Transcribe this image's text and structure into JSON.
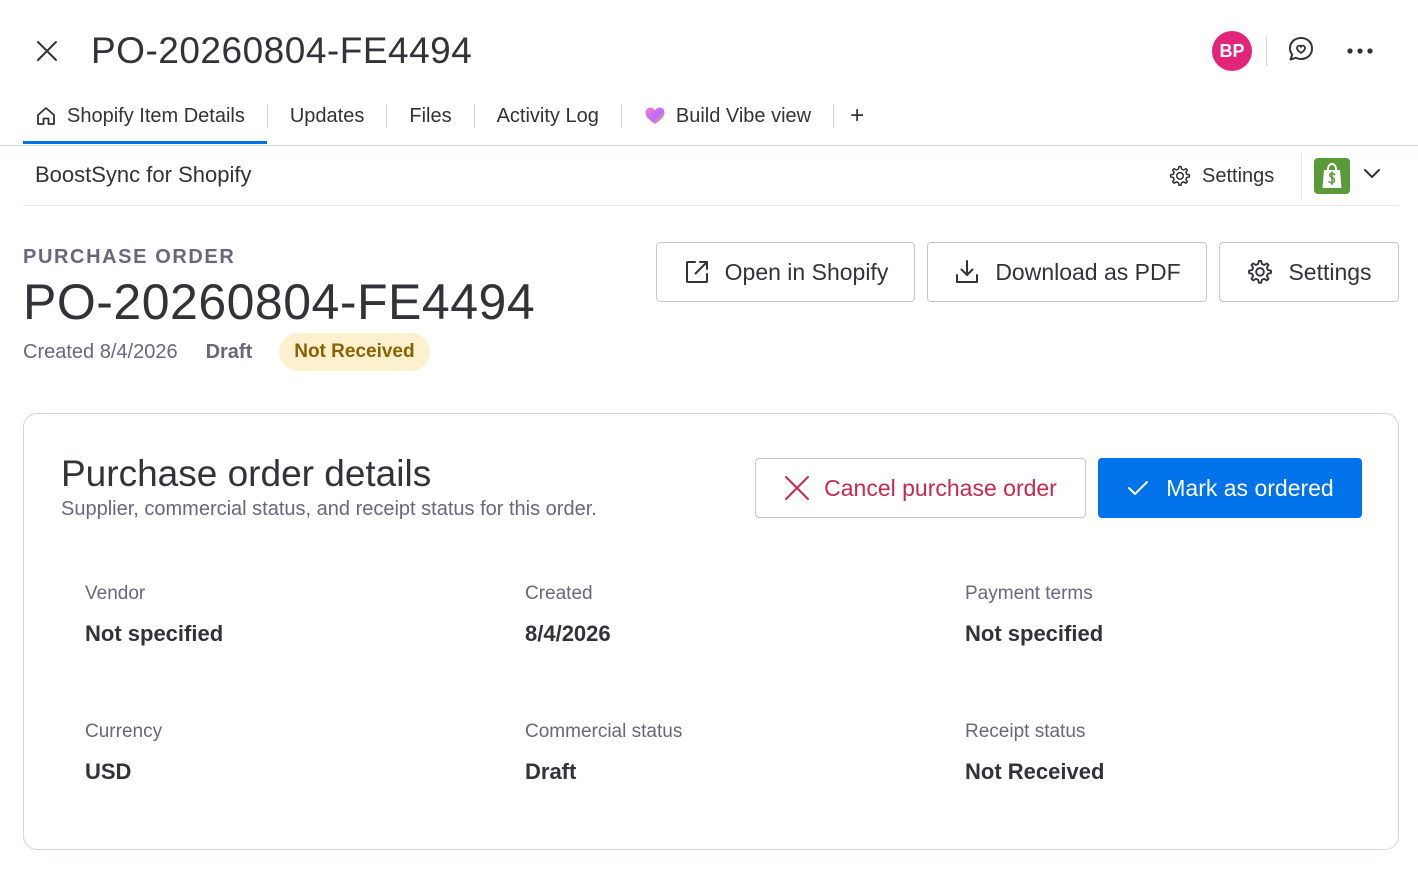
{
  "header": {
    "title": "PO-20260804-FE4494",
    "avatar_initials": "BP",
    "avatar_color": "#e2247a",
    "close_icon": "close-icon",
    "chat_icon": "chat-bubble-icon",
    "more_icon": "more-horizontal-icon"
  },
  "tabs": [
    {
      "label": "Shopify Item Details",
      "icon": "home-icon",
      "active": true
    },
    {
      "label": "Updates"
    },
    {
      "label": "Files"
    },
    {
      "label": "Activity Log"
    },
    {
      "label": "Build Vibe view",
      "icon": "vibe-heart-icon"
    },
    {
      "label": "+"
    }
  ],
  "app_bar": {
    "name": "BoostSync for Shopify",
    "settings_label": "Settings",
    "logo_icon": "shopify-bag-icon",
    "logo_color": "#5a9a3a"
  },
  "po": {
    "kicker": "PURCHASE ORDER",
    "number": "PO-20260804-FE4494",
    "created": "Created 8/4/2026",
    "state": "Draft",
    "badge": "Not Received",
    "badge_bg": "#fdf0cf",
    "badge_color": "#8a6200"
  },
  "actions": {
    "open_shopify": "Open in Shopify",
    "download_pdf": "Download as PDF",
    "settings": "Settings"
  },
  "card": {
    "title": "Purchase order details",
    "subtitle": "Supplier, commercial status, and receipt status for this order.",
    "cancel_label": "Cancel purchase order",
    "mark_label": "Mark as ordered",
    "accent": "#0073ea",
    "danger": "#c6284f",
    "fields": [
      {
        "label": "Vendor",
        "value": "Not specified"
      },
      {
        "label": "Created",
        "value": "8/4/2026"
      },
      {
        "label": "Payment terms",
        "value": "Not specified"
      },
      {
        "label": "Currency",
        "value": "USD"
      },
      {
        "label": "Commercial status",
        "value": "Draft"
      },
      {
        "label": "Receipt status",
        "value": "Not Received"
      }
    ]
  }
}
